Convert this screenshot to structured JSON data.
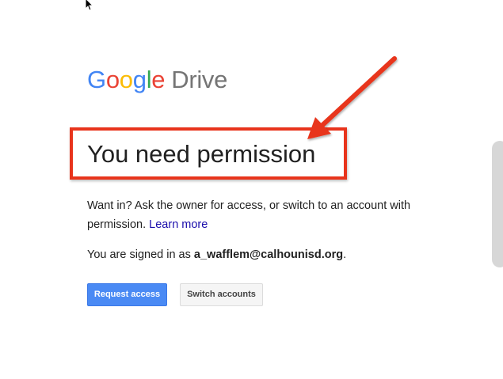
{
  "logo": {
    "letters": [
      {
        "char": "G",
        "color": "#4285f4"
      },
      {
        "char": "o",
        "color": "#ea4335"
      },
      {
        "char": "o",
        "color": "#fbbc05"
      },
      {
        "char": "g",
        "color": "#4285f4"
      },
      {
        "char": "l",
        "color": "#34a853"
      },
      {
        "char": "e",
        "color": "#ea4335"
      }
    ],
    "product": "Drive"
  },
  "main": {
    "title": "You need permission",
    "description": "Want in? Ask the owner for access, or switch to an account with permission.",
    "learn_more": "Learn more",
    "signed_in_prefix": "You are signed in as ",
    "email": "a_wafflem@calhounisd.org",
    "signed_in_suffix": "."
  },
  "buttons": {
    "request_access": "Request access",
    "switch_accounts": "Switch accounts"
  },
  "annotation": {
    "color": "#e8341c"
  },
  "colors": {
    "primary_button": "#4a8af4",
    "link": "#1a0dab"
  }
}
